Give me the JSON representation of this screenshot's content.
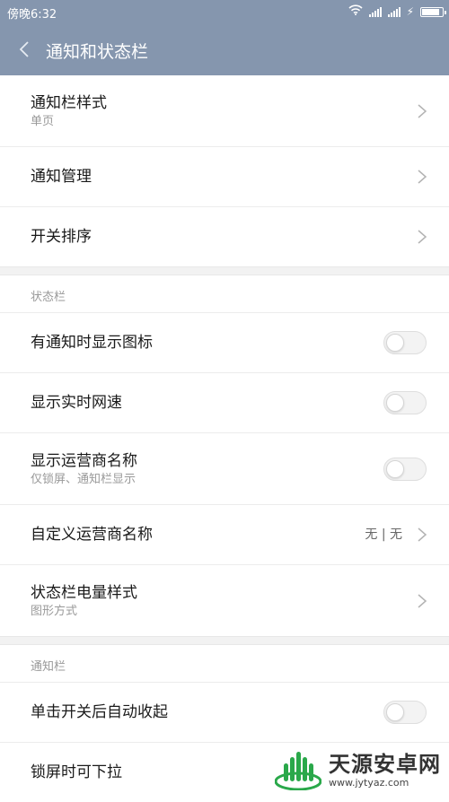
{
  "status_bar": {
    "time": "傍晚6:32",
    "icons": [
      "wifi-icon",
      "signal-icon",
      "signal-icon",
      "charging-icon",
      "battery-icon"
    ],
    "battery_level": 0.85
  },
  "header": {
    "back_icon": "chevron-left-icon",
    "title": "通知和状态栏"
  },
  "groups": [
    {
      "label": "",
      "rows": [
        {
          "title": "通知栏样式",
          "subtitle": "单页",
          "control": "chevron"
        },
        {
          "title": "通知管理",
          "subtitle": "",
          "control": "chevron"
        },
        {
          "title": "开关排序",
          "subtitle": "",
          "control": "chevron"
        }
      ]
    },
    {
      "label": "状态栏",
      "rows": [
        {
          "title": "有通知时显示图标",
          "subtitle": "",
          "control": "toggle",
          "on": false
        },
        {
          "title": "显示实时网速",
          "subtitle": "",
          "control": "toggle",
          "on": false
        },
        {
          "title": "显示运营商名称",
          "subtitle": "仅锁屏、通知栏显示",
          "control": "toggle",
          "on": false
        },
        {
          "title": "自定义运营商名称",
          "subtitle": "",
          "value": "无 | 无",
          "control": "chevron"
        },
        {
          "title": "状态栏电量样式",
          "subtitle": "图形方式",
          "control": "chevron"
        }
      ]
    },
    {
      "label": "通知栏",
      "rows": [
        {
          "title": "单击开关后自动收起",
          "subtitle": "",
          "control": "toggle",
          "on": false
        },
        {
          "title": "锁屏时可下拉",
          "subtitle": "",
          "control": "none"
        }
      ]
    }
  ],
  "watermark": {
    "title": "天源安卓网",
    "url": "www.jytyaz.com",
    "color": "#2aa84a"
  },
  "colors": {
    "header_bg": "#8596ae",
    "page_bg": "#f7f7f7"
  }
}
